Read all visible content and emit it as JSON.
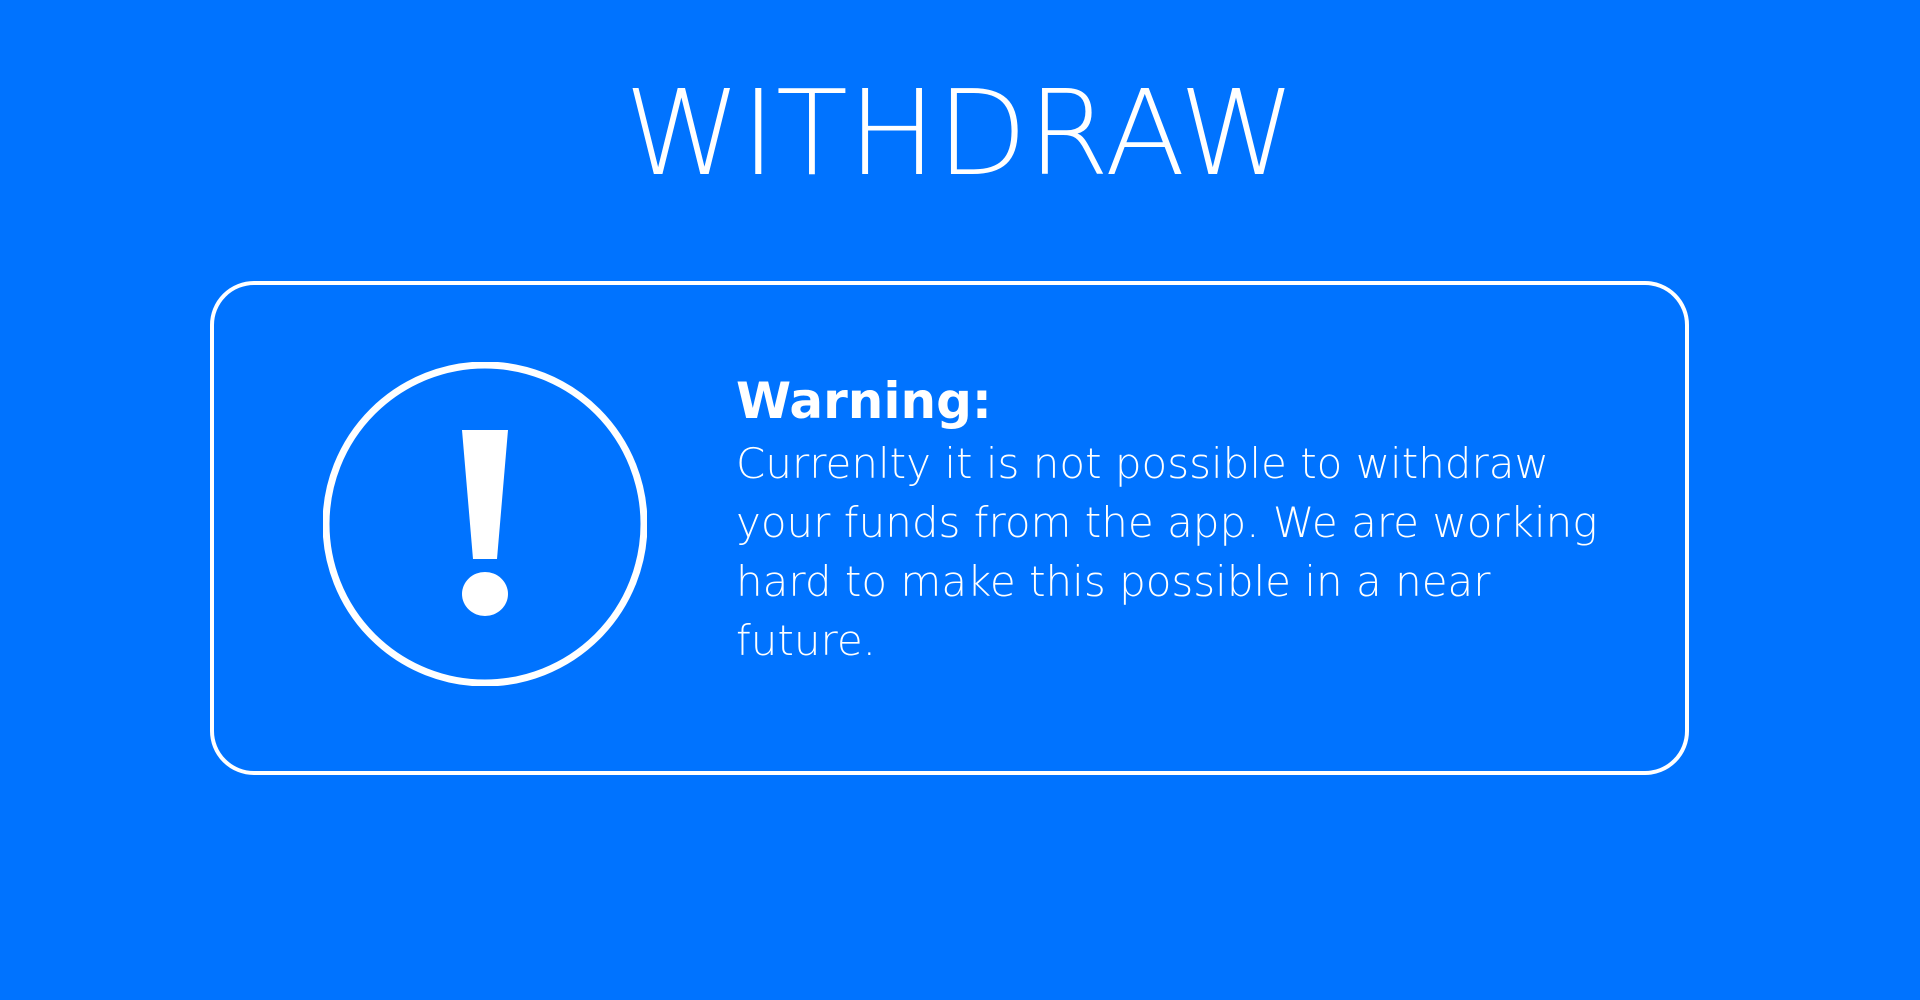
{
  "header": {
    "title": "WITHDRAW"
  },
  "notice": {
    "icon": "exclamation-circle-icon",
    "heading": "Warning:",
    "body_lines": [
      "Currenlty it is not possible to withdraw",
      "your funds from the app. We are working",
      "hard to make this possible in a near",
      "future."
    ]
  },
  "colors": {
    "background": "#0073FF",
    "foreground": "#FFFFFF"
  }
}
